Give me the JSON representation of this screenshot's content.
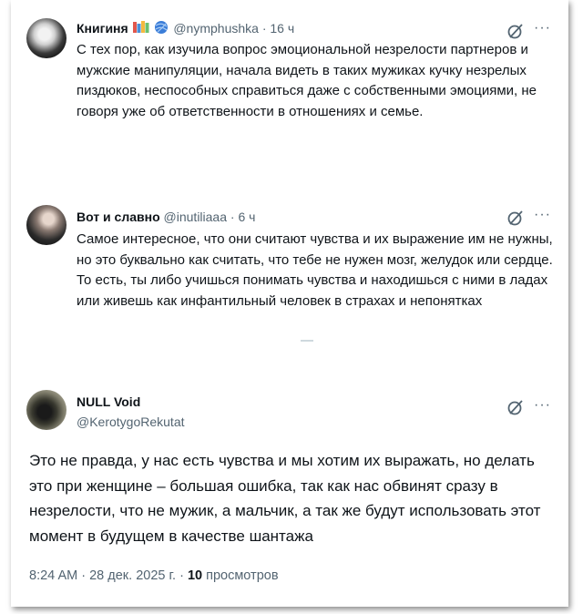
{
  "tweets": [
    {
      "author": "Книгиня",
      "badge_icons": [
        "books-icon",
        "yarn-icon"
      ],
      "handle": "@nymphushka",
      "time": "· 16 ч",
      "text": "С тех пор, как изучила вопрос эмоциональной незрелости партнеров и мужские манипуляции, начала видеть в таких мужиках кучку незрелых пиздюков, неспособных справиться даже с собственными эмоциями, не говоря уже об ответственности в отношениях и семье."
    },
    {
      "author": "Вот и славно",
      "handle": "@inutiliaaa",
      "time": "· 6 ч",
      "text": "Самое интересное, что они считают чувства и их выражение им не нужны, но это буквально как считать, что тебе не нужен мозг, желудок или сердце. То есть, ты либо учишься понимать чувства и находишься с ними в ладах или живешь как инфантильный человек в страхах и непонятках"
    },
    {
      "author": "NULL Void",
      "handle": "@KerotygoRekutat",
      "text": "Это не правда, у нас есть чувства и мы хотим их выражать, но делать это при женщине – большая ошибка, так как нас обвинят сразу в незрелости, что не мужик, а мальчик, а так же будут использовать этот момент в будущем в качестве шантажа"
    }
  ],
  "footer": {
    "time": "8:24 AM",
    "dot1": "·",
    "date": "28 дек. 2025 г.",
    "dot2": "·",
    "views_count": "10",
    "views_label": "просмотров"
  },
  "icons": {
    "grok": "grok-icon",
    "more": "more-icon",
    "more_glyph": "···"
  },
  "colors": {
    "text": "#0f1419",
    "muted": "#536471"
  }
}
